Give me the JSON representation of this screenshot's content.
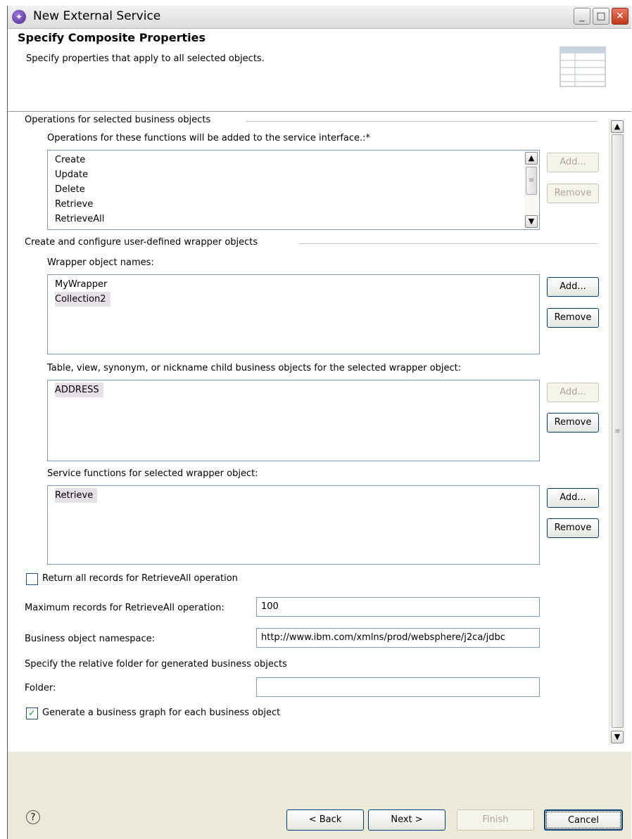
{
  "window": {
    "title": "New External Service"
  },
  "header": {
    "title": "Specify Composite Properties",
    "description": "Specify properties that apply to all selected objects."
  },
  "operations": {
    "group_label": "Operations for selected business objects",
    "list_label": "Operations for these functions will be added to the service interface.:*",
    "items": [
      "Create",
      "Update",
      "Delete",
      "Retrieve",
      "RetrieveAll"
    ],
    "add_label": "Add...",
    "remove_label": "Remove"
  },
  "wrappers": {
    "group_label": "Create and configure user-defined wrapper objects",
    "names_label": "Wrapper object names:",
    "names": [
      "MyWrapper",
      "Collection2"
    ],
    "names_selected": "Collection2",
    "children_label": "Table, view, synonym, or nickname child business objects for the selected wrapper object:",
    "children": [
      "ADDRESS"
    ],
    "functions_label": "Service functions for selected wrapper object:",
    "functions": [
      "Retrieve"
    ],
    "add_label": "Add...",
    "remove_label": "Remove"
  },
  "options": {
    "return_all_label": "Return all records for RetrieveAll operation",
    "return_all_checked": false,
    "max_records_label": "Maximum records for RetrieveAll operation:",
    "max_records_value": "100",
    "namespace_label": "Business object namespace:",
    "namespace_value": "http://www.ibm.com/xmlns/prod/websphere/j2ca/jdbc",
    "relative_folder_label": "Specify the relative folder for generated business objects",
    "folder_label": "Folder:",
    "folder_value": "",
    "generate_graph_label": "Generate a business graph for each business object",
    "generate_graph_checked": true
  },
  "footer": {
    "help_symbol": "?",
    "back_label": "< Back",
    "next_label": "Next >",
    "finish_label": "Finish",
    "cancel_label": "Cancel"
  },
  "icons": {
    "window_minimize": "_",
    "window_maximize": "□",
    "window_close": "✕",
    "scroll_up": "▲",
    "scroll_down": "▼",
    "thumb_grip": "≡",
    "check_mark": "✓"
  }
}
